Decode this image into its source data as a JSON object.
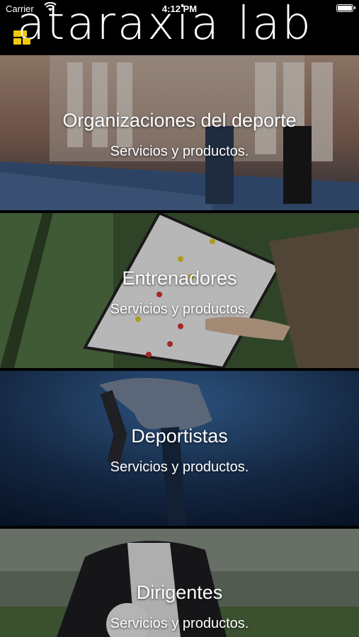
{
  "status_bar": {
    "carrier": "Carrier",
    "time": "4:12 PM"
  },
  "header": {
    "brand": "ataraxia lab",
    "logo_icon": "four-square-logo-icon",
    "accent_color": "#f2c80f"
  },
  "cards": [
    {
      "title": "Organizaciones del deporte",
      "subtitle": "Servicios y productos."
    },
    {
      "title": "Entrenadores",
      "subtitle": "Servicios y productos."
    },
    {
      "title": "Deportistas",
      "subtitle": "Servicios y productos."
    },
    {
      "title": "Dirigentes",
      "subtitle": "Servicios y productos."
    }
  ]
}
